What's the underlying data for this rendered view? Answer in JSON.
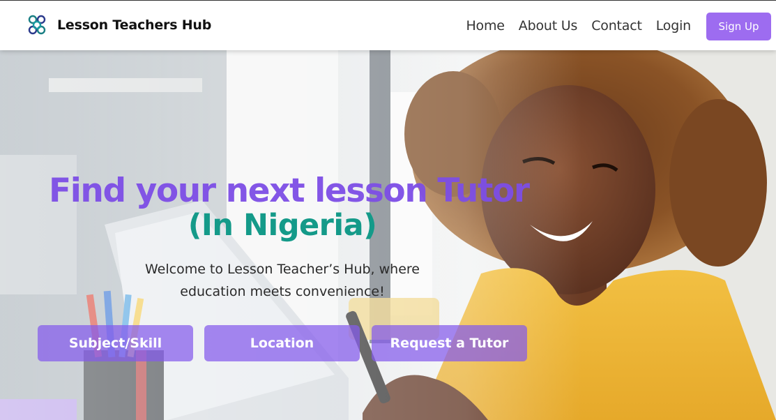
{
  "brand": {
    "name": "Lesson Teachers Hub",
    "logo_icon": "molecule-logo-icon"
  },
  "nav": {
    "items": [
      {
        "label": "Home"
      },
      {
        "label": "About Us"
      },
      {
        "label": "Contact"
      },
      {
        "label": "Login"
      }
    ],
    "signup_label": "Sign Up"
  },
  "hero": {
    "headline": "Find your next lesson Tutor",
    "subhead": "(In Nigeria)",
    "welcome_line1": "Welcome to Lesson Teacher’s Hub, where",
    "welcome_line2": "education meets convenience!",
    "buttons": [
      {
        "label": "Subject/Skill"
      },
      {
        "label": "Location"
      },
      {
        "label": "Request a Tutor"
      }
    ]
  },
  "colors": {
    "accent": "#9d6cf0",
    "headline": "#7d4ee6",
    "subhead": "#149a89",
    "button": "#845aec"
  }
}
